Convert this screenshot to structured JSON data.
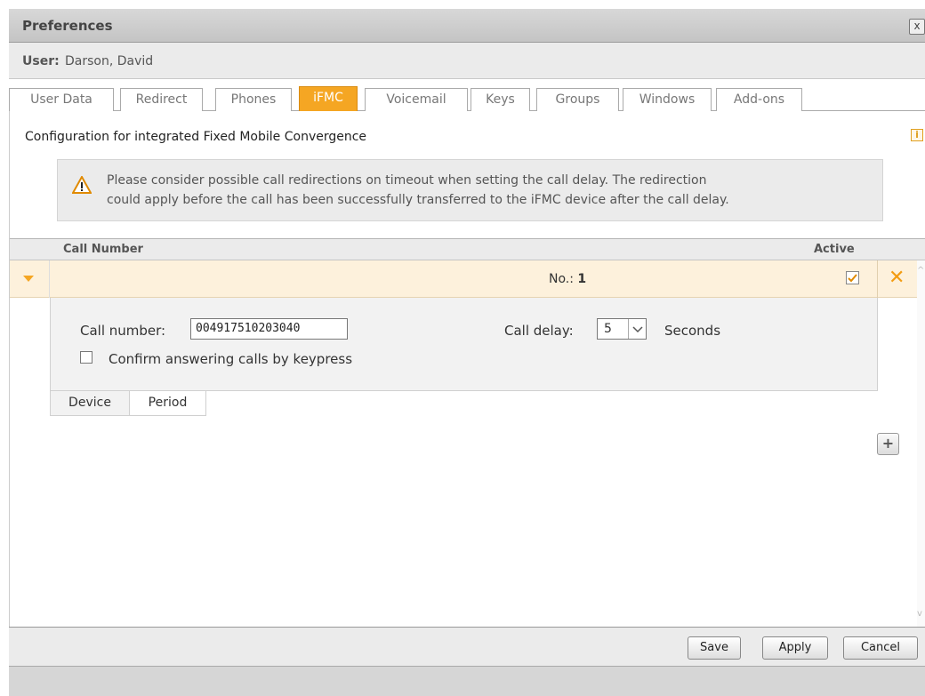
{
  "window": {
    "title": "Preferences",
    "close_label": "x"
  },
  "user": {
    "label": "User:",
    "name": "Darson, David"
  },
  "tabs": [
    {
      "label": "User Data"
    },
    {
      "label": "Redirect"
    },
    {
      "label": "Phones"
    },
    {
      "label": "iFMC",
      "active": true
    },
    {
      "label": "Voicemail"
    },
    {
      "label": "Keys"
    },
    {
      "label": "Groups"
    },
    {
      "label": "Windows"
    },
    {
      "label": "Add-ons"
    }
  ],
  "config": {
    "title": "Configuration for integrated Fixed Mobile Convergence",
    "info_icon": "info-icon",
    "info_glyph": "i"
  },
  "warning": {
    "icon": "warning-icon",
    "line1": "Please consider possible call redirections on timeout when setting the call delay. The redirection",
    "line2": "could apply before the call has been successfully transferred to the iFMC device after the call delay."
  },
  "table": {
    "col_call_number": "Call Number",
    "col_active": "Active",
    "rows": [
      {
        "no_label": "No.:",
        "no_value": "1",
        "active": true
      }
    ]
  },
  "detail": {
    "call_number_label": "Call number:",
    "call_number_value": "004917510203040",
    "call_delay_label": "Call delay:",
    "call_delay_value": "5",
    "seconds_label": "Seconds",
    "confirm_label": "Confirm answering calls by keypress",
    "confirm_checked": false
  },
  "subtabs": {
    "device": "Device",
    "period": "Period"
  },
  "add_glyph": "+",
  "footer": {
    "save": "Save",
    "apply": "Apply",
    "cancel": "Cancel"
  },
  "colors": {
    "accent": "#f5a623",
    "row_highlight": "#fdf1dc"
  }
}
